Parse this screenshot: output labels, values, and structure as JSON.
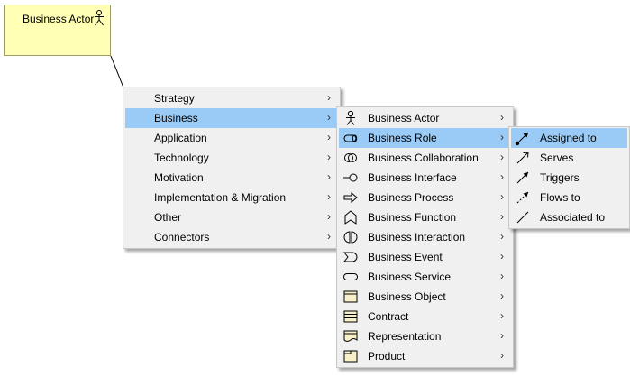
{
  "canvas": {
    "actor_box": {
      "title": "Business Actor",
      "fill": "#ffffb5"
    }
  },
  "colors": {
    "highlight": "#99cbf6",
    "menu_bg": "#f0f0f0"
  },
  "submenu_arrow": "›",
  "menu1": {
    "items": [
      {
        "label": "Strategy"
      },
      {
        "label": "Business",
        "highlighted": true
      },
      {
        "label": "Application"
      },
      {
        "label": "Technology"
      },
      {
        "label": "Motivation"
      },
      {
        "label": "Implementation & Migration"
      },
      {
        "label": "Other"
      },
      {
        "label": "Connectors"
      }
    ]
  },
  "menu2": {
    "items": [
      {
        "label": "Business Actor",
        "icon": "actor-icon"
      },
      {
        "label": "Business Role",
        "icon": "role-icon",
        "highlighted": true
      },
      {
        "label": "Business Collaboration",
        "icon": "collaboration-icon"
      },
      {
        "label": "Business Interface",
        "icon": "interface-icon"
      },
      {
        "label": "Business Process",
        "icon": "process-icon"
      },
      {
        "label": "Business Function",
        "icon": "function-icon"
      },
      {
        "label": "Business Interaction",
        "icon": "interaction-icon"
      },
      {
        "label": "Business Event",
        "icon": "event-icon"
      },
      {
        "label": "Business Service",
        "icon": "service-icon"
      },
      {
        "label": "Business Object",
        "icon": "object-icon"
      },
      {
        "label": "Contract",
        "icon": "contract-icon"
      },
      {
        "label": "Representation",
        "icon": "representation-icon"
      },
      {
        "label": "Product",
        "icon": "product-icon"
      }
    ]
  },
  "menu3": {
    "items": [
      {
        "label": "Assigned to",
        "icon": "assignment-relation-icon",
        "highlighted": true
      },
      {
        "label": "Serves",
        "icon": "serving-relation-icon"
      },
      {
        "label": "Triggers",
        "icon": "triggering-relation-icon"
      },
      {
        "label": "Flows to",
        "icon": "flow-relation-icon"
      },
      {
        "label": "Associated to",
        "icon": "association-relation-icon"
      }
    ]
  }
}
